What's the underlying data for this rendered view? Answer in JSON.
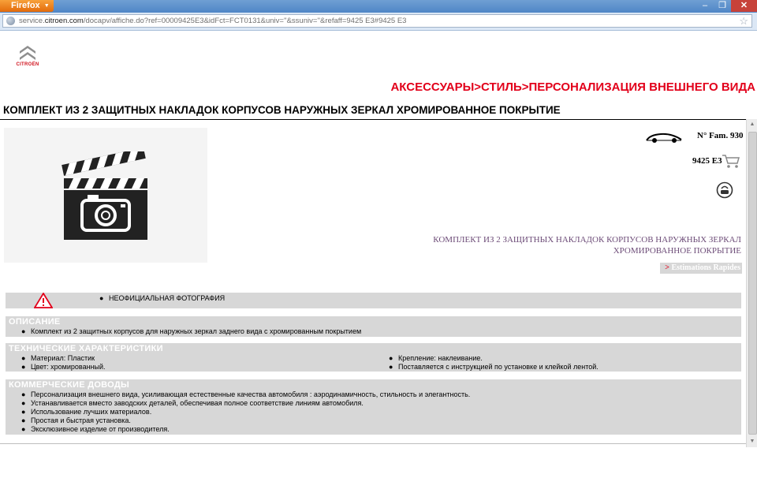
{
  "browser": {
    "app_button": "Firefox",
    "url_prefix": "service.",
    "url_domain": "citroen.com",
    "url_rest": "/docapv/affiche.do?ref=00009425E3&idFct=FCT0131&univ=''&ssuniv=''&refaff=9425 E3#9425 E3"
  },
  "logo": {
    "text": "CITROËN"
  },
  "breadcrumb": "АКСЕССУАРЫ>СТИЛЬ>ПЕРСОНАЛИЗАЦИЯ ВНЕШНЕГО ВИДА",
  "page_title": "КОМПЛЕКТ ИЗ 2 ЗАЩИТНЫХ НАКЛАДОК КОРПУСОВ НАРУЖНЫХ ЗЕРКАЛ ХРОМИРОВАННОЕ ПОКРЫТИЕ",
  "product": {
    "fam": "N° Fam. 930",
    "reference": "9425 E3",
    "name_line1": "КОМПЛЕКТ ИЗ 2 ЗАЩИТНЫХ НАКЛАДОК КОРПУСОВ НАРУЖНЫХ ЗЕРКАЛ",
    "name_line2": "ХРОМИРОВАННОЕ ПОКРЫТИЕ",
    "estimations_label": "Estimations Rapides"
  },
  "warning": {
    "text": "НЕОФИЦИАЛЬНАЯ ФОТОГРАФИЯ"
  },
  "description": {
    "title": "ОПИСАНИЕ",
    "items": [
      "Комплект из 2 защитных корпусов для наружных зеркал заднего вида с хромированным покрытием"
    ]
  },
  "technical": {
    "title": "ТЕХНИЧЕСКИЕ ХАРАКТЕРИСТИКИ",
    "left_items": [
      "Материал: Пластик",
      "Цвет: хромированный."
    ],
    "right_items": [
      "Крепление: наклеивание.",
      "Поставляется с инструкцией по установке и клейкой лентой."
    ]
  },
  "commercial": {
    "title": "КОММЕРЧЕСКИЕ ДОВОДЫ",
    "items": [
      "Персонализация внешнего вида, усиливающая естественные качества автомобиля : аэродинамичность, стильность и элегантность.",
      "Устанавливается вместо заводских деталей, обеспечивая полное соответствие линиям автомобиля.",
      "Использование лучших материалов.",
      "Простая и быстрая установка.",
      "Эксклюзивное изделие от производителя."
    ]
  },
  "colors": {
    "brand_red": "#e2001a",
    "section_gray": "#d7d7d7",
    "product_purple": "#6d4c78"
  },
  "icons": [
    "globe-icon",
    "star-icon",
    "citroen-logo-icon",
    "camera-clapper-icon",
    "car-icon",
    "cart-icon",
    "help-icon",
    "warning-icon"
  ]
}
